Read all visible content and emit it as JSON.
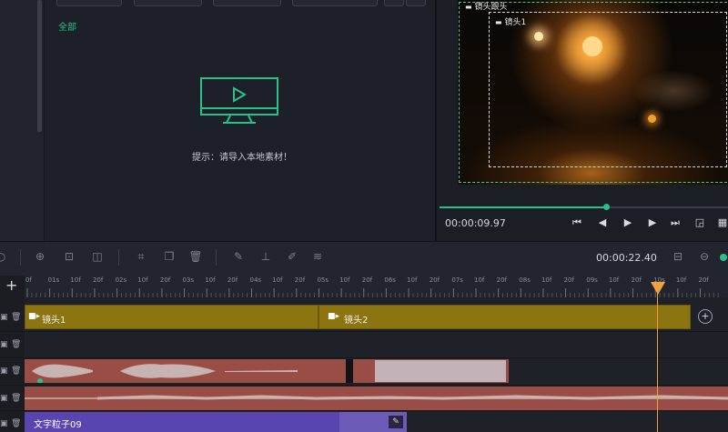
{
  "media": {
    "tab_all": "全部",
    "hint": "提示：请导入本地素材！"
  },
  "preview": {
    "outer_label": "镜头跟头",
    "inner_label": "镜头1",
    "current_time": "00:00:09.97",
    "progress_fraction": 0.58
  },
  "timeline": {
    "total_time": "00:00:22.40",
    "add_track_label": "+",
    "ruler_labels": [
      "0f",
      "01s",
      "10f",
      "20f",
      "02s",
      "10f",
      "20f",
      "03s",
      "10f",
      "20f",
      "04s",
      "10f",
      "20f",
      "05s",
      "10f",
      "20f",
      "06s",
      "10f",
      "20f",
      "07s",
      "10f",
      "20f",
      "08s",
      "10f",
      "20f",
      "09s",
      "10f",
      "20f",
      "10s",
      "10f",
      "20f"
    ],
    "shots": [
      {
        "label": "镜头1"
      },
      {
        "label": "镜头2"
      }
    ],
    "text_clip_label": "文字粒子09"
  },
  "colors": {
    "accent_green": "#27c28a",
    "shot_clip": "#8c7410",
    "audio_clip": "#9a4d45",
    "text_clip": "#5a45b0",
    "playhead": "#f0a23a"
  },
  "icons": {
    "monitor": "monitor-play-icon",
    "video_camera": "video-camera-icon"
  }
}
